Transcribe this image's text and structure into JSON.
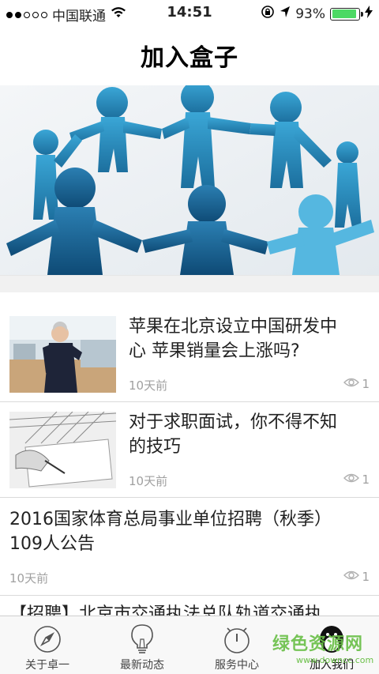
{
  "status_bar": {
    "carrier": "中国联通",
    "time": "14:51",
    "battery_percent": "93%",
    "battery_level": 0.93,
    "signal_dots_filled": 2,
    "signal_dots_total": 5
  },
  "nav": {
    "title": "加入盒子"
  },
  "news": [
    {
      "title_line1": "苹果在北京设立中国研发中",
      "title_line2": "心 苹果销量会上涨吗?",
      "time": "10天前",
      "views": "1"
    },
    {
      "title_line1": "对于求职面试，你不得不知",
      "title_line2": "的技巧",
      "time": "10天前",
      "views": "1"
    },
    {
      "title_line1": "2016国家体育总局事业单位招聘（秋季）",
      "title_line2": "109人公告",
      "time": "10天前",
      "views": "1"
    },
    {
      "title_line1": "【招聘】北京市交通执法总队轨道交通执"
    }
  ],
  "tabs": [
    {
      "label": "关于卓一",
      "icon": "compass-icon"
    },
    {
      "label": "最新动态",
      "icon": "lightbulb-icon"
    },
    {
      "label": "服务中心",
      "icon": "timer-icon"
    },
    {
      "label": "加入我们",
      "icon": "penguin-icon",
      "active": true
    }
  ],
  "watermark": {
    "main": "绿色资源网",
    "sub": "www.downcc.com"
  },
  "colors": {
    "battery": "#4cd964",
    "banner_figures": "#2a8fc2",
    "watermark": "#6cc04a"
  }
}
